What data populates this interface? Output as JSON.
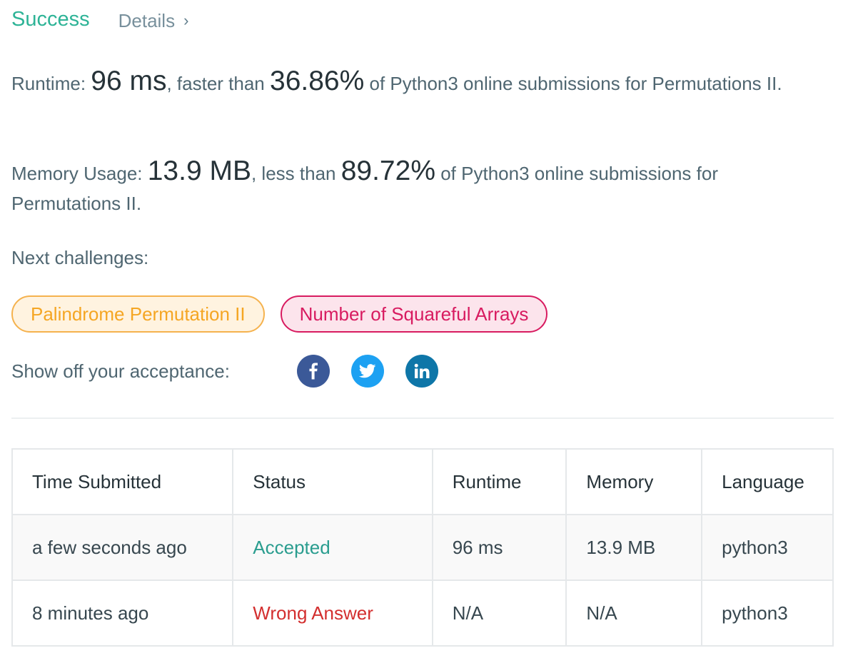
{
  "header": {
    "status": "Success",
    "details_label": "Details",
    "details_chevron": "›"
  },
  "runtime": {
    "label": "Runtime: ",
    "value": "96 ms",
    "mid": ", faster than ",
    "percent": "36.86%",
    "tail": " of Python3 online submissions for Permutations II."
  },
  "memory": {
    "label": "Memory Usage: ",
    "value": "13.9 MB",
    "mid": ", less than ",
    "percent": "89.72%",
    "tail": " of Python3 online submissions for Permutations II."
  },
  "next": {
    "label": "Next challenges:",
    "challenges": [
      {
        "title": "Palindrome Permutation II",
        "difficulty": "medium",
        "color": "#f5a623"
      },
      {
        "title": "Number of Squareful Arrays",
        "difficulty": "hard",
        "color": "#d81b60"
      }
    ]
  },
  "share": {
    "label": "Show off your acceptance:",
    "icons": [
      "facebook-icon",
      "twitter-icon",
      "linkedin-icon"
    ],
    "colors": {
      "facebook": "#3b5998",
      "twitter": "#1da1f2",
      "linkedin": "#0e76a8"
    }
  },
  "table": {
    "headers": [
      "Time Submitted",
      "Status",
      "Runtime",
      "Memory",
      "Language"
    ],
    "rows": [
      {
        "time": "a few seconds ago",
        "status": "Accepted",
        "runtime": "96 ms",
        "memory": "13.9 MB",
        "language": "python3"
      },
      {
        "time": "8 minutes ago",
        "status": "Wrong Answer",
        "runtime": "N/A",
        "memory": "N/A",
        "language": "python3"
      }
    ]
  },
  "colors": {
    "success": "#2db396",
    "accepted": "#2a9d8f",
    "wrong": "#d32f2f"
  }
}
